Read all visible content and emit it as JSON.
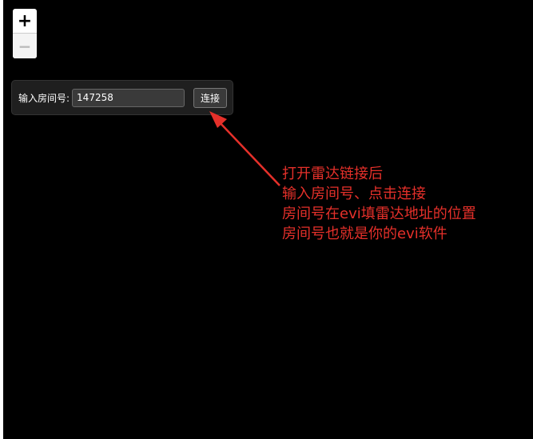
{
  "zoom": {
    "in_label": "+",
    "out_label": "−"
  },
  "room_form": {
    "label": "输入房间号:",
    "value": "147258",
    "connect_label": "连接"
  },
  "annotation": {
    "lines": [
      "打开雷达链接后",
      "输入房间号、点击连接",
      "房间号在evi填雷达地址的位置",
      "房间号也就是你的evi软件"
    ],
    "color": "#e5302a"
  },
  "colors": {
    "background": "#000000",
    "panel": "#1f1f1f",
    "annotation": "#e5302a"
  }
}
